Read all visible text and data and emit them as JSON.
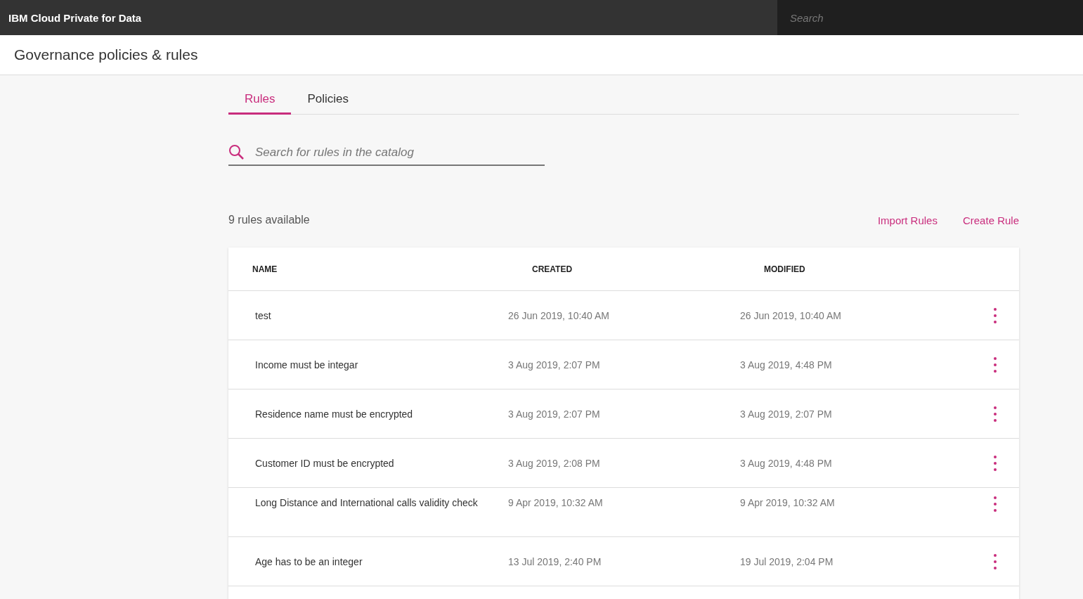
{
  "topbar": {
    "title": "IBM Cloud Private for Data",
    "search": {
      "placeholder": "Search"
    }
  },
  "page_title": "Governance policies & rules",
  "tabs": [
    {
      "label": "Rules",
      "selected": true
    },
    {
      "label": "Policies",
      "selected": false
    }
  ],
  "rule_search": {
    "placeholder": "Search for rules in the catalog"
  },
  "count": "9 rules available",
  "actions": [
    "Import Rules",
    "Create Rule"
  ],
  "table": {
    "columns": [
      "NAME",
      "CREATED",
      "MODIFIED"
    ],
    "rows": [
      {
        "name": "test",
        "created": "26 Jun 2019, 10:40 AM",
        "modified": "26 Jun 2019, 10:40 AM"
      },
      {
        "name": "Income must be integar",
        "created": "3 Aug 2019, 2:07 PM",
        "modified": "3 Aug 2019, 4:48 PM"
      },
      {
        "name": "Residence name must be encrypted",
        "created": "3 Aug 2019, 2:07 PM",
        "modified": "3 Aug 2019, 2:07 PM"
      },
      {
        "name": "Customer ID must be encrypted",
        "created": "3 Aug 2019, 2:08 PM",
        "modified": "3 Aug 2019, 4:48 PM"
      },
      {
        "name": "Long Distance and International calls validity check",
        "created": "9 Apr 2019, 10:32 AM",
        "modified": "9 Apr 2019, 10:32 AM"
      },
      {
        "name": "Age has to be an integer",
        "created": "13 Jul 2019, 2:40 PM",
        "modified": "19 Jul 2019, 2:04 PM"
      }
    ]
  }
}
